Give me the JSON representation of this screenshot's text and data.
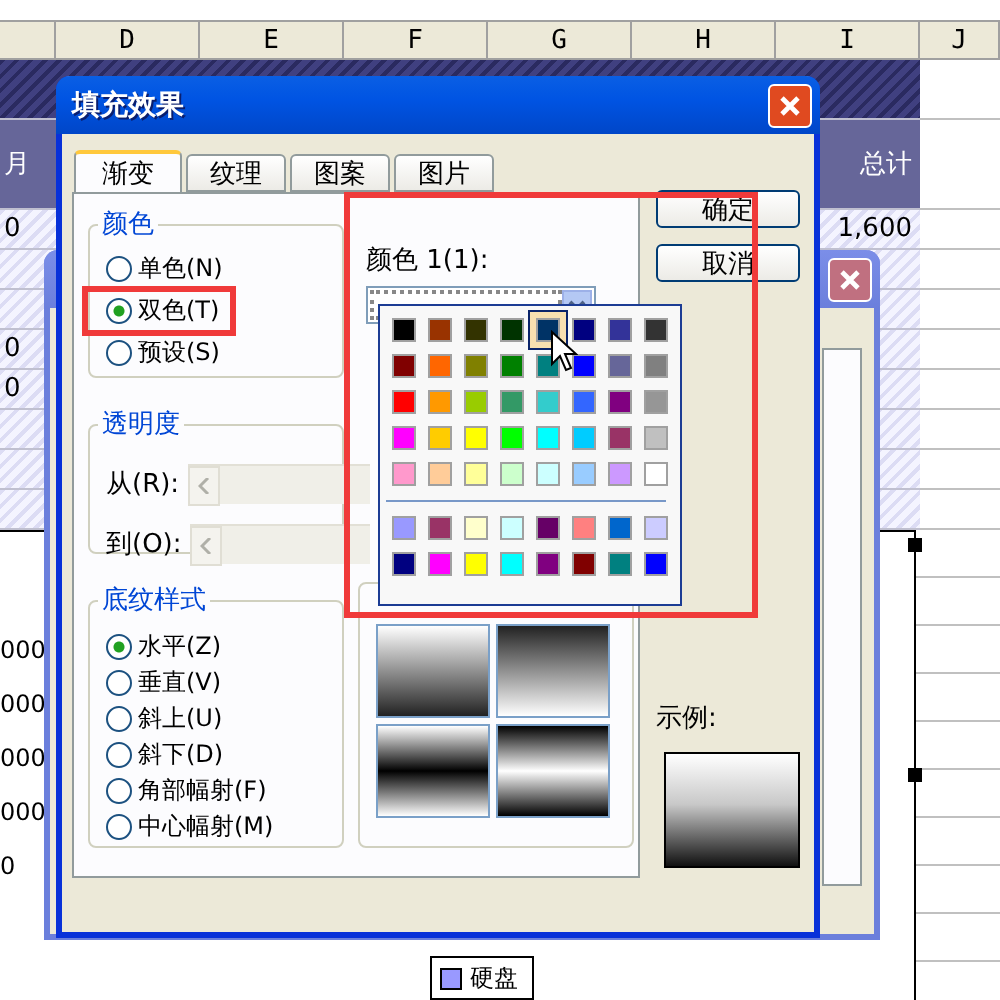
{
  "sheet": {
    "columns": [
      "D",
      "E",
      "F",
      "G",
      "H",
      "I",
      "J"
    ],
    "header": {
      "col_1": "月",
      "total": "总计"
    },
    "rows": [
      {
        "col_1": "0",
        "total": "1,600"
      },
      {},
      {},
      {
        "col_1": "0"
      },
      {
        "col_1": "0"
      },
      {},
      {},
      {}
    ]
  },
  "chart": {
    "axis_labels": [
      "000",
      "000",
      "000",
      "000",
      "0"
    ],
    "legend": {
      "label": "硬盘",
      "color": "#9999ff"
    }
  },
  "dialog": {
    "title": "填充效果",
    "tabs": [
      {
        "label": "渐变",
        "selected": true
      },
      {
        "label": "纹理",
        "selected": false
      },
      {
        "label": "图案",
        "selected": false
      },
      {
        "label": "图片",
        "selected": false
      }
    ],
    "color_group": {
      "title": "颜色",
      "options": [
        {
          "label": "单色(N)",
          "selected": false
        },
        {
          "label": "双色(T)",
          "selected": true
        },
        {
          "label": "预设(S)",
          "selected": false
        }
      ]
    },
    "transparency": {
      "title": "透明度",
      "from_label": "从(R):",
      "to_label": "到(O):",
      "disabled": true
    },
    "color1": {
      "label": "颜色 1(1):",
      "palette": [
        [
          {
            "color": "#000000",
            "selected": false
          },
          {
            "color": "#993300",
            "selected": false
          },
          {
            "color": "#333300",
            "selected": false
          },
          {
            "color": "#003300",
            "selected": false
          },
          {
            "color": "#003366",
            "selected": true
          },
          {
            "color": "#000080",
            "selected": false
          },
          {
            "color": "#333399",
            "selected": false
          },
          {
            "color": "#333333",
            "selected": false
          }
        ],
        [
          {
            "color": "#800000",
            "selected": false
          },
          {
            "color": "#ff6600",
            "selected": false
          },
          {
            "color": "#808000",
            "selected": false
          },
          {
            "color": "#008000",
            "selected": false
          },
          {
            "color": "#008080",
            "selected": false
          },
          {
            "color": "#0000ff",
            "selected": false
          },
          {
            "color": "#666699",
            "selected": false
          },
          {
            "color": "#808080",
            "selected": false
          }
        ],
        [
          {
            "color": "#ff0000",
            "selected": false
          },
          {
            "color": "#ff9900",
            "selected": false
          },
          {
            "color": "#99cc00",
            "selected": false
          },
          {
            "color": "#339966",
            "selected": false
          },
          {
            "color": "#33cccc",
            "selected": false
          },
          {
            "color": "#3366ff",
            "selected": false
          },
          {
            "color": "#800080",
            "selected": false
          },
          {
            "color": "#969696",
            "selected": false
          }
        ],
        [
          {
            "color": "#ff00ff",
            "selected": false
          },
          {
            "color": "#ffcc00",
            "selected": false
          },
          {
            "color": "#ffff00",
            "selected": false
          },
          {
            "color": "#00ff00",
            "selected": false
          },
          {
            "color": "#00ffff",
            "selected": false
          },
          {
            "color": "#00ccff",
            "selected": false
          },
          {
            "color": "#993366",
            "selected": false
          },
          {
            "color": "#c0c0c0",
            "selected": false
          }
        ],
        [
          {
            "color": "#ff99cc",
            "selected": false
          },
          {
            "color": "#ffcc99",
            "selected": false
          },
          {
            "color": "#ffff99",
            "selected": false
          },
          {
            "color": "#ccffcc",
            "selected": false
          },
          {
            "color": "#ccffff",
            "selected": false
          },
          {
            "color": "#99ccff",
            "selected": false
          },
          {
            "color": "#cc99ff",
            "selected": false
          },
          {
            "color": "#ffffff",
            "selected": false
          }
        ]
      ],
      "chart_palette": [
        [
          {
            "color": "#9999ff",
            "selected": false
          },
          {
            "color": "#993366",
            "selected": false
          },
          {
            "color": "#ffffcc",
            "selected": false
          },
          {
            "color": "#ccffff",
            "selected": false
          },
          {
            "color": "#660066",
            "selected": false
          },
          {
            "color": "#ff8080",
            "selected": false
          },
          {
            "color": "#0066cc",
            "selected": false
          },
          {
            "color": "#ccccff",
            "selected": false
          }
        ],
        [
          {
            "color": "#000080",
            "selected": false
          },
          {
            "color": "#ff00ff",
            "selected": false
          },
          {
            "color": "#ffff00",
            "selected": false
          },
          {
            "color": "#00ffff",
            "selected": false
          },
          {
            "color": "#800080",
            "selected": false
          },
          {
            "color": "#800000",
            "selected": false
          },
          {
            "color": "#008080",
            "selected": false
          },
          {
            "color": "#0000ff",
            "selected": false
          }
        ]
      ]
    },
    "shading": {
      "title": "底纹样式",
      "options": [
        {
          "label": "水平(Z)",
          "selected": true
        },
        {
          "label": "垂直(V)",
          "selected": false
        },
        {
          "label": "斜上(U)",
          "selected": false
        },
        {
          "label": "斜下(D)",
          "selected": false
        },
        {
          "label": "角部幅射(F)",
          "selected": false
        },
        {
          "label": "中心幅射(M)",
          "selected": false
        }
      ]
    },
    "buttons": [
      "确定",
      "取消"
    ],
    "sample_label": "示例:"
  }
}
